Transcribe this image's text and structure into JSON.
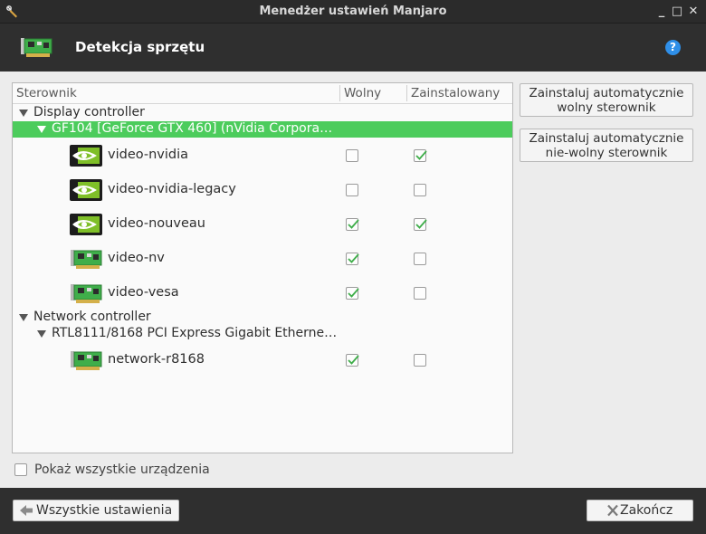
{
  "window": {
    "title": "Menedżer ustawień Manjaro",
    "controls": [
      "_",
      "□",
      "✕"
    ]
  },
  "header": {
    "title": "Detekcja sprzętu",
    "help": "?"
  },
  "table": {
    "columns": [
      "Sterownik",
      "Wolny",
      "Zainstalowany"
    ],
    "groups": [
      {
        "label": "Display controller",
        "device": "GF104 [GeForce GTX 460] (nVidia Corpora…",
        "drivers": [
          {
            "name": "video-nvidia",
            "icon": "nvidia-icon",
            "free": false,
            "installed": true
          },
          {
            "name": "video-nvidia-legacy",
            "icon": "nvidia-icon",
            "free": false,
            "installed": false
          },
          {
            "name": "video-nouveau",
            "icon": "nvidia-icon",
            "free": true,
            "installed": true
          },
          {
            "name": "video-nv",
            "icon": "pci-card-icon",
            "free": true,
            "installed": false
          },
          {
            "name": "video-vesa",
            "icon": "pci-card-icon",
            "free": true,
            "installed": false
          }
        ]
      },
      {
        "label": "Network controller",
        "device": "RTL8111/8168 PCI Express Gigabit Etherne…",
        "drivers": [
          {
            "name": "network-r8168",
            "icon": "pci-card-icon",
            "free": true,
            "installed": false
          }
        ]
      }
    ]
  },
  "actions": {
    "install_free": "Zainstaluj automatycznie\nwolny sterownik",
    "install_nonfree": "Zainstaluj automatycznie\nnie-wolny sterownik"
  },
  "show_all": {
    "label": "Pokaż wszystkie urządzenia",
    "checked": false
  },
  "footer": {
    "back_label": "Wszystkie ustawienia",
    "close_label": "Zakończ"
  }
}
